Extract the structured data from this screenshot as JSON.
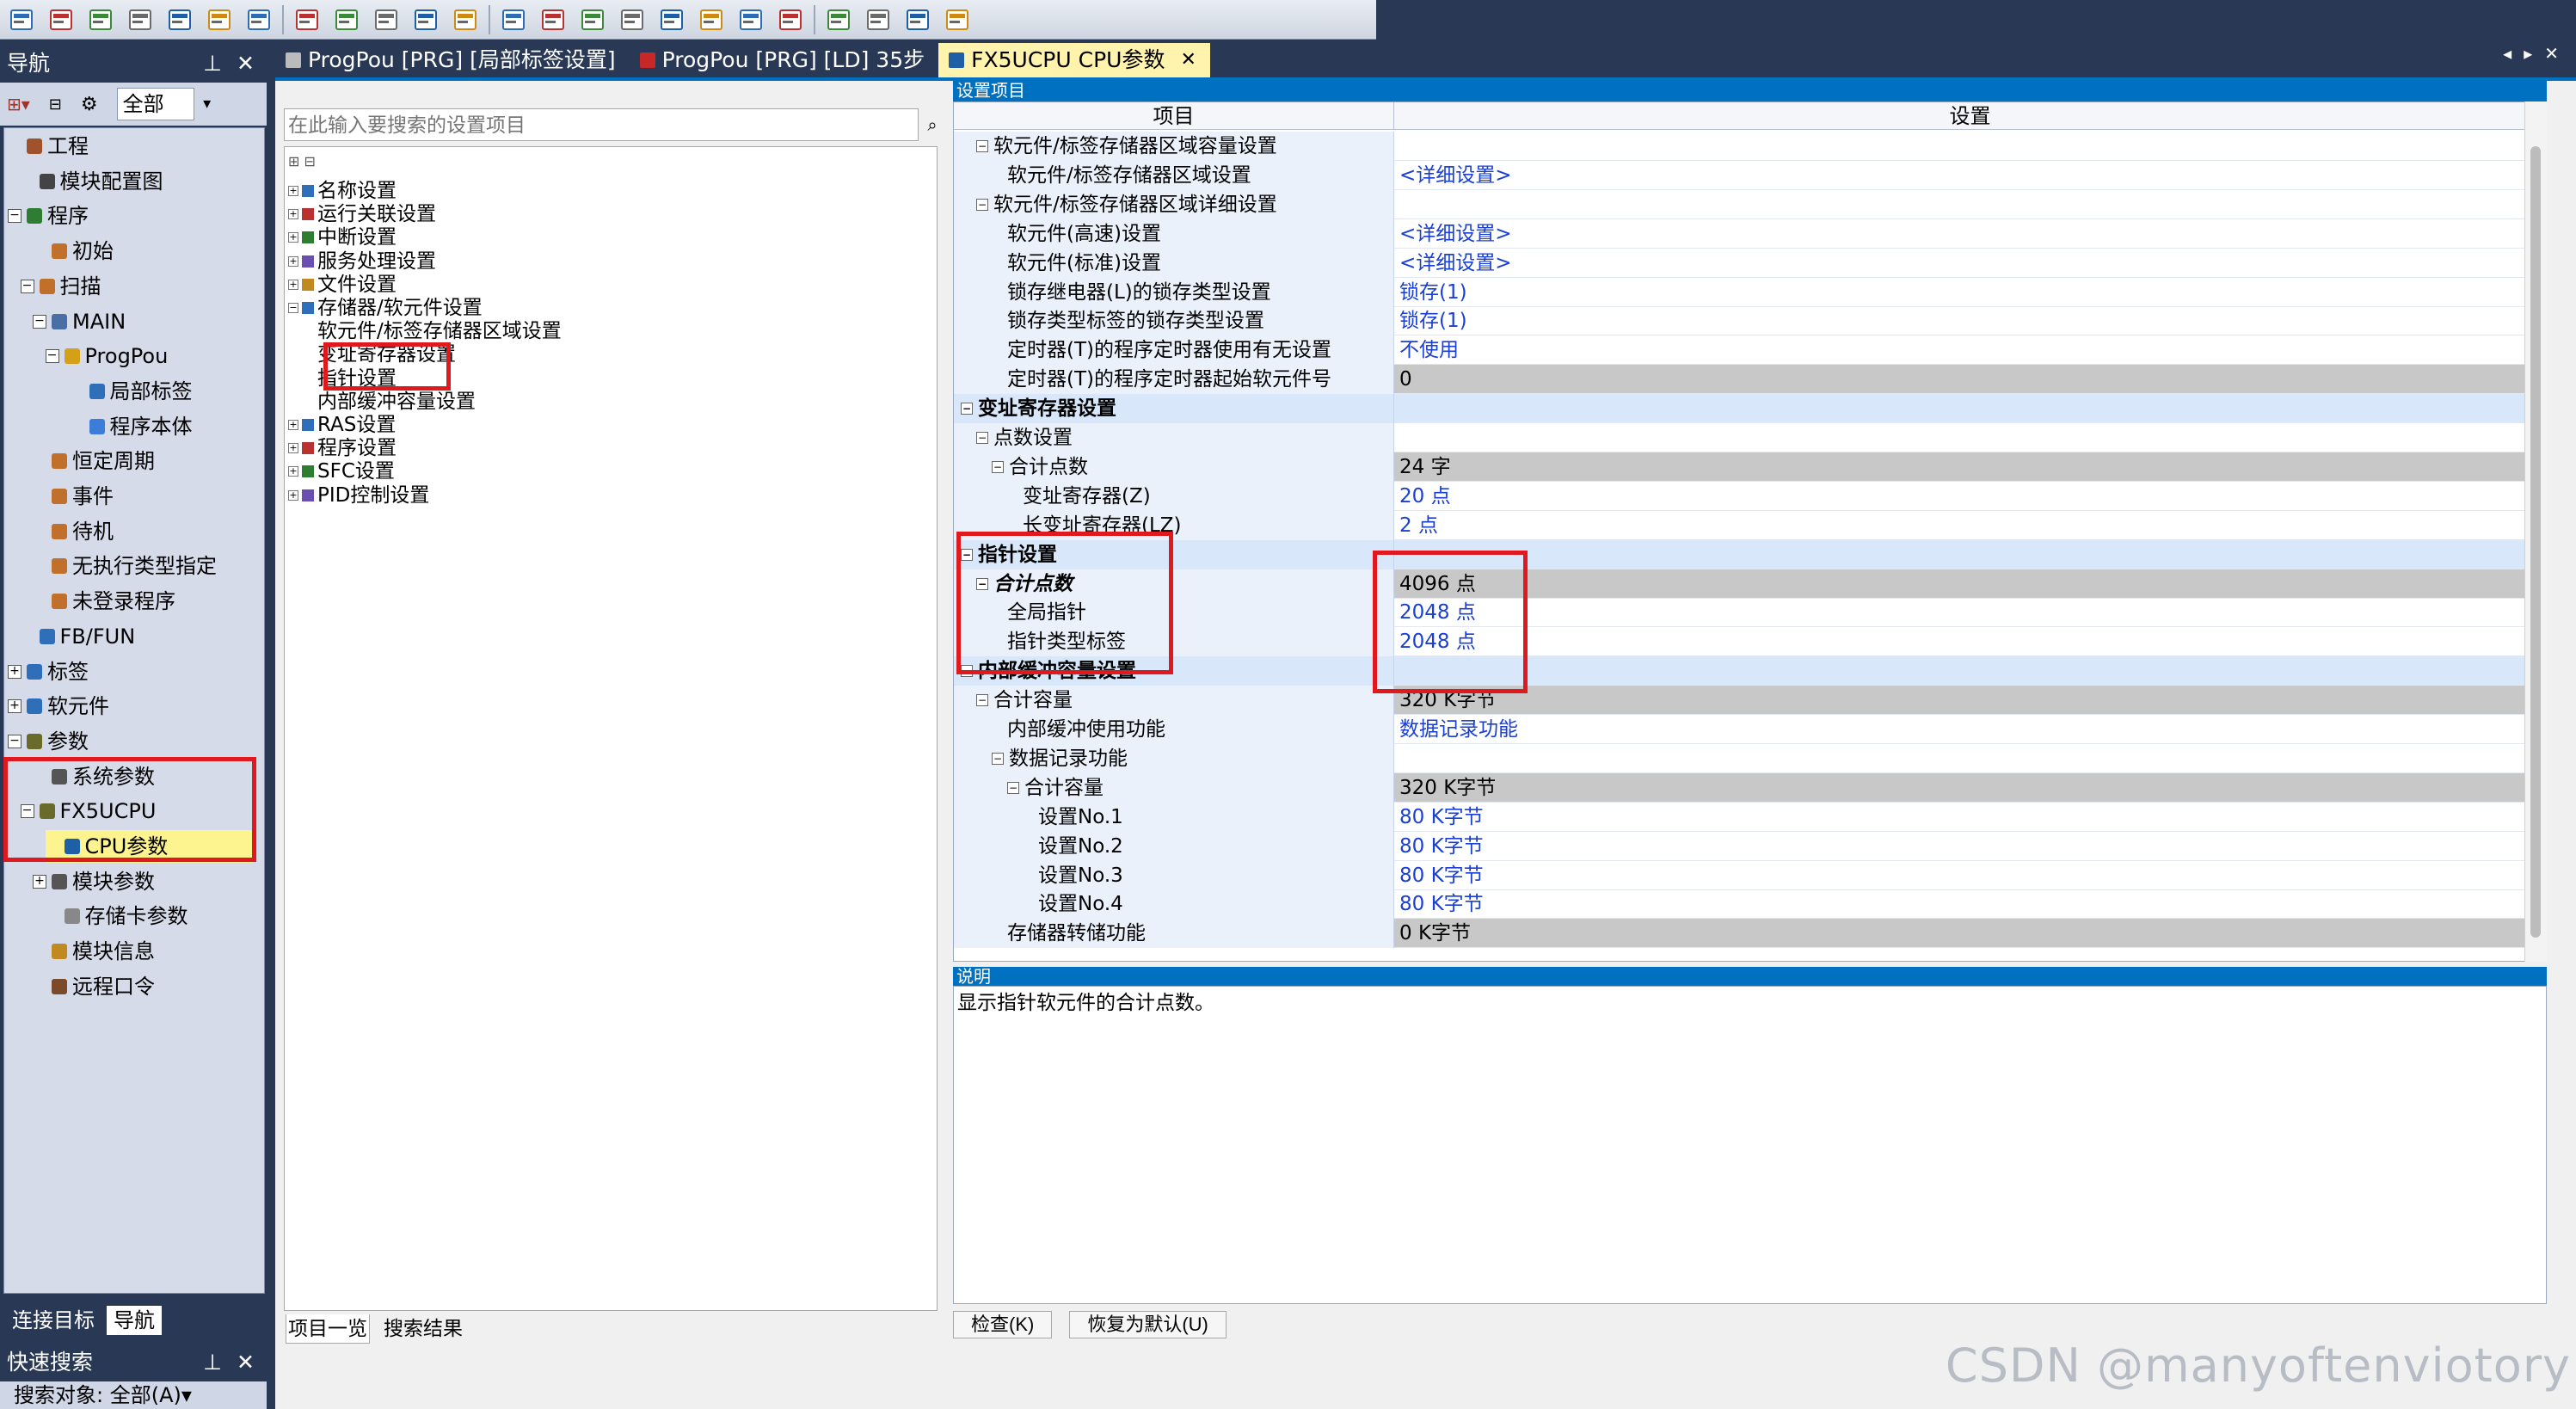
{
  "toolbar": {
    "icons": [
      "project-icon",
      "save-icon",
      "print-icon",
      "module-icon",
      "window-icon",
      "table-icon",
      "device-icon",
      "monitor-icon",
      "dev1-icon",
      "dev2-icon",
      "dev3-icon",
      "dev4-icon",
      "zoom-icon",
      "find-icon",
      "list-icon",
      "edit-icon",
      "check-icon",
      "compile-icon",
      "tool-icon",
      "watch-icon",
      "search-icon",
      "display-icon",
      "print2-icon",
      "layout-icon"
    ]
  },
  "nav": {
    "title": "导航",
    "pin": "ᵖ",
    "close": "✕",
    "filter": "全部",
    "tree": [
      {
        "label": "工程",
        "level": 0,
        "icon": "project"
      },
      {
        "label": "模块配置图",
        "level": 1,
        "icon": "config"
      },
      {
        "label": "程序",
        "level": 0,
        "exp": "−",
        "icon": "program"
      },
      {
        "label": "初始",
        "level": 2,
        "icon": "lock"
      },
      {
        "label": "扫描",
        "level": 1,
        "exp": "−",
        "icon": "lock"
      },
      {
        "label": "MAIN",
        "level": 2,
        "exp": "−",
        "icon": "main"
      },
      {
        "label": "ProgPou",
        "level": 3,
        "exp": "−",
        "icon": "pou"
      },
      {
        "label": "局部标签",
        "level": 5,
        "icon": "label"
      },
      {
        "label": "程序本体",
        "level": 5,
        "icon": "body"
      },
      {
        "label": "恒定周期",
        "level": 2,
        "icon": "lock"
      },
      {
        "label": "事件",
        "level": 2,
        "icon": "lock"
      },
      {
        "label": "待机",
        "level": 2,
        "icon": "lock"
      },
      {
        "label": "无执行类型指定",
        "level": 2,
        "icon": "lock"
      },
      {
        "label": "未登录程序",
        "level": 2,
        "icon": "lock"
      },
      {
        "label": "FB/FUN",
        "level": 1,
        "icon": "fb"
      },
      {
        "label": "标签",
        "level": 0,
        "exp": "+",
        "icon": "label"
      },
      {
        "label": "软元件",
        "level": 0,
        "exp": "+",
        "icon": "device"
      },
      {
        "label": "参数",
        "level": 0,
        "exp": "−",
        "icon": "param"
      },
      {
        "label": "系统参数",
        "level": 2,
        "icon": "sys"
      },
      {
        "label": "FX5UCPU",
        "level": 1,
        "exp": "−",
        "icon": "cpu"
      },
      {
        "label": "CPU参数",
        "level": 3,
        "icon": "cpuparam",
        "selected": true
      },
      {
        "label": "模块参数",
        "level": 2,
        "exp": "+",
        "icon": "modparam"
      },
      {
        "label": "存储卡参数",
        "level": 3,
        "icon": "card"
      },
      {
        "label": "模块信息",
        "level": 2,
        "icon": "modinfo"
      },
      {
        "label": "远程口令",
        "level": 2,
        "icon": "remote"
      }
    ],
    "tabs": [
      "连接目标",
      "导航"
    ]
  },
  "quick_search": {
    "title": "快速搜索",
    "target": "搜索对象: 全部(A)▾"
  },
  "doc_tabs": [
    {
      "label": "ProgPou [PRG] [局部标签设置]",
      "active": false
    },
    {
      "label": "ProgPou [PRG] [LD] 35步",
      "active": false
    },
    {
      "label": "FX5UCPU CPU参数",
      "active": true
    }
  ],
  "setting_tree": {
    "search_placeholder": "在此输入要搜索的设置项目",
    "items": [
      {
        "label": "名称设置",
        "exp": "+",
        "level": 0
      },
      {
        "label": "运行关联设置",
        "exp": "+",
        "level": 0
      },
      {
        "label": "中断设置",
        "exp": "+",
        "level": 0
      },
      {
        "label": "服务处理设置",
        "exp": "+",
        "level": 0
      },
      {
        "label": "文件设置",
        "exp": "+",
        "level": 0
      },
      {
        "label": "存储器/软元件设置",
        "exp": "−",
        "level": 0
      },
      {
        "label": "软元件/标签存储器区域设置",
        "level": 1
      },
      {
        "label": "变址寄存器设置",
        "level": 1
      },
      {
        "label": "指针设置",
        "level": 1
      },
      {
        "label": "内部缓冲容量设置",
        "level": 1
      },
      {
        "label": "RAS设置",
        "exp": "+",
        "level": 0
      },
      {
        "label": "程序设置",
        "exp": "+",
        "level": 0
      },
      {
        "label": "SFC设置",
        "exp": "+",
        "level": 0
      },
      {
        "label": "PID控制设置",
        "exp": "+",
        "level": 0
      }
    ],
    "bottom_tabs": [
      "项目一览",
      "搜索结果"
    ]
  },
  "grid": {
    "section_title": "设置项目",
    "col_item": "项目",
    "col_setting": "设置",
    "rows": [
      {
        "k": "软元件/标签存储器区域容量设置",
        "v": "",
        "indent": 1,
        "mk": "−",
        "group": false,
        "style": ""
      },
      {
        "k": "软元件/标签存储器区域设置",
        "v": "<详细设置>",
        "indent": 3,
        "style": "link"
      },
      {
        "k": "软元件/标签存储器区域详细设置",
        "v": "",
        "indent": 1,
        "mk": "−",
        "style": ""
      },
      {
        "k": "软元件(高速)设置",
        "v": "<详细设置>",
        "indent": 3,
        "style": "link"
      },
      {
        "k": "软元件(标准)设置",
        "v": "<详细设置>",
        "indent": 3,
        "style": "link"
      },
      {
        "k": "锁存继电器(L)的锁存类型设置",
        "v": "锁存(1)",
        "indent": 3,
        "style": "link"
      },
      {
        "k": "锁存类型标签的锁存类型设置",
        "v": "锁存(1)",
        "indent": 3,
        "style": "link"
      },
      {
        "k": "定时器(T)的程序定时器使用有无设置",
        "v": "不使用",
        "indent": 3,
        "style": "link"
      },
      {
        "k": "定时器(T)的程序定时器起始软元件号",
        "v": "0",
        "indent": 3,
        "style": "gray"
      },
      {
        "k": "变址寄存器设置",
        "v": "",
        "indent": 0,
        "mk": "−",
        "group": true
      },
      {
        "k": "点数设置",
        "v": "",
        "indent": 1,
        "mk": "−",
        "style": ""
      },
      {
        "k": "合计点数",
        "v": "24 字",
        "indent": 2,
        "mk": "−",
        "style": "gray"
      },
      {
        "k": "变址寄存器(Z)",
        "v": "20 点",
        "indent": 4,
        "style": "link"
      },
      {
        "k": "长变址寄存器(LZ)",
        "v": "2 点",
        "indent": 4,
        "style": "link"
      },
      {
        "k": "指针设置",
        "v": "",
        "indent": 0,
        "mk": "−",
        "group": true
      },
      {
        "k": "合计点数",
        "v": "4096 点",
        "indent": 1,
        "mk": "−",
        "style": "gray",
        "italic": true
      },
      {
        "k": "全局指针",
        "v": "2048 点",
        "indent": 3,
        "style": "link"
      },
      {
        "k": "指针类型标签",
        "v": "2048 点",
        "indent": 3,
        "style": "link"
      },
      {
        "k": "内部缓冲容量设置",
        "v": "",
        "indent": 0,
        "mk": "−",
        "group": true
      },
      {
        "k": "合计容量",
        "v": "320 K字节",
        "indent": 1,
        "mk": "−",
        "style": "gray"
      },
      {
        "k": "内部缓冲使用功能",
        "v": "数据记录功能",
        "indent": 3,
        "style": "link"
      },
      {
        "k": "数据记录功能",
        "v": "",
        "indent": 2,
        "mk": "−",
        "style": ""
      },
      {
        "k": "合计容量",
        "v": "320 K字节",
        "indent": 3,
        "mk": "−",
        "style": "gray"
      },
      {
        "k": "设置No.1",
        "v": "80 K字节",
        "indent": 5,
        "style": "link"
      },
      {
        "k": "设置No.2",
        "v": "80 K字节",
        "indent": 5,
        "style": "link"
      },
      {
        "k": "设置No.3",
        "v": "80 K字节",
        "indent": 5,
        "style": "link"
      },
      {
        "k": "设置No.4",
        "v": "80 K字节",
        "indent": 5,
        "style": "link"
      },
      {
        "k": "存储器转储功能",
        "v": "0 K字节",
        "indent": 3,
        "style": "gray"
      }
    ]
  },
  "description": {
    "title": "说明",
    "text": "显示指针软元件的合计点数。"
  },
  "buttons": {
    "check": "检查(K)",
    "reset": "恢复为默认(U)"
  },
  "watermark": "CSDN @manyoftenviotory",
  "colors": {
    "accent": "#0070c0",
    "highlight": "#e0191e",
    "nav_bg": "#293955",
    "selected": "#fdf48f"
  }
}
